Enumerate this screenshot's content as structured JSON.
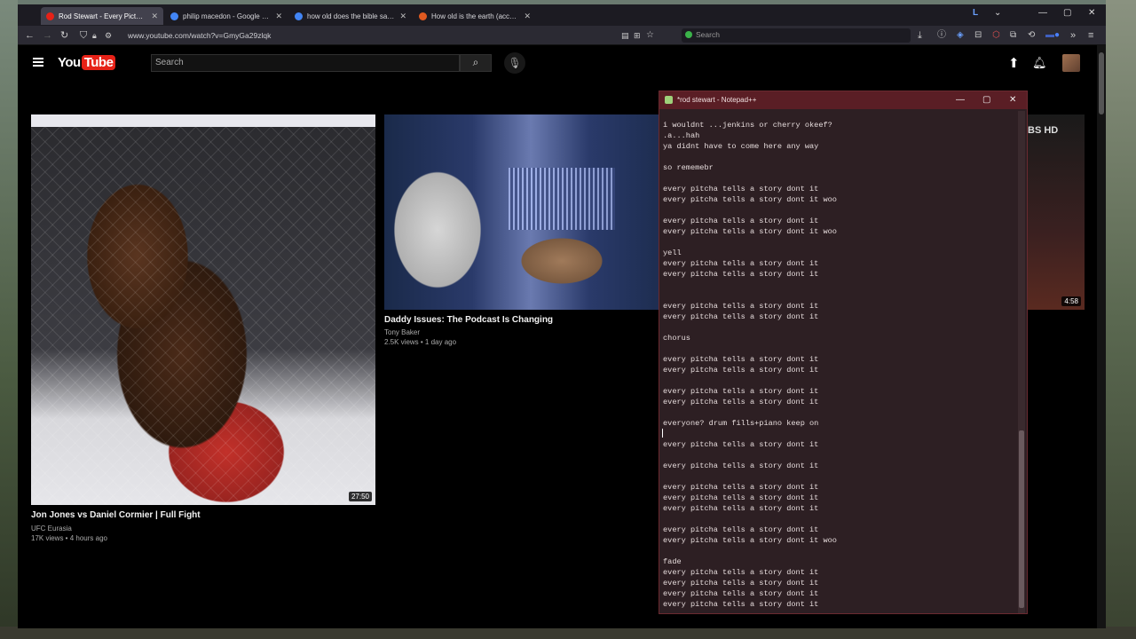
{
  "browser": {
    "tabs": [
      {
        "label": "Rod Stewart - Every Picture Tell",
        "active": true,
        "favicon_color": "#e62117"
      },
      {
        "label": "philip macedon - Google Search",
        "active": false,
        "favicon_color": "#4285f4"
      },
      {
        "label": "how old does the bible say the",
        "active": false,
        "favicon_color": "#4285f4"
      },
      {
        "label": "How old is the earth (according",
        "active": false,
        "favicon_color": "#e05a20"
      }
    ],
    "url": "www.youtube.com/watch?v=GmyGa29zlqk",
    "search_placeholder": "Search"
  },
  "youtube": {
    "logo_you": "You",
    "logo_tube": "Tube",
    "search_placeholder": "Search",
    "videos": [
      {
        "title": "Jon Jones vs Daniel Cormier | Full Fight",
        "channel": "UFC Eurasia",
        "meta": "17K views • 4 hours ago",
        "duration": "27:50"
      },
      {
        "title": "Daddy Issues: The Podcast Is Changing",
        "channel": "Tony Baker",
        "meta": "2.5K views • 1 day ago"
      },
      {
        "badge": "BS HD",
        "duration": "4:58"
      }
    ]
  },
  "notepad": {
    "title": "*rod stewart - Notepad++",
    "lines": [
      "i wouldnt ...jenkins or cherry okeef?",
      ".a...hah",
      "ya didnt have to come here any way",
      "",
      "so rememebr",
      "",
      "every pitcha tells a story dont it",
      "every pitcha tells a story dont it woo",
      "",
      "every pitcha tells a story dont it",
      "every pitcha tells a story dont it woo",
      "",
      "yell",
      "every pitcha tells a story dont it",
      "every pitcha tells a story dont it",
      "",
      "",
      "every pitcha tells a story dont it",
      "every pitcha tells a story dont it",
      "",
      "chorus",
      "",
      "every pitcha tells a story dont it",
      "every pitcha tells a story dont it",
      "",
      "every pitcha tells a story dont it",
      "every pitcha tells a story dont it",
      "",
      "everyone? drum fills+piano keep on",
      "",
      "every pitcha tells a story dont it",
      "",
      "every pitcha tells a story dont it",
      "",
      "every pitcha tells a story dont it",
      "every pitcha tells a story dont it",
      "every pitcha tells a story dont it",
      "",
      "every pitcha tells a story dont it",
      "every pitcha tells a story dont it woo",
      "",
      "fade",
      "every pitcha tells a story dont it",
      "every pitcha tells a story dont it",
      "every pitcha tells a story dont it",
      "every pitcha tells a story dont it"
    ]
  },
  "colors": {
    "yt_red": "#e62117",
    "npp_titlebar": "#5a1e25",
    "npp_bg": "#2d1f23"
  }
}
